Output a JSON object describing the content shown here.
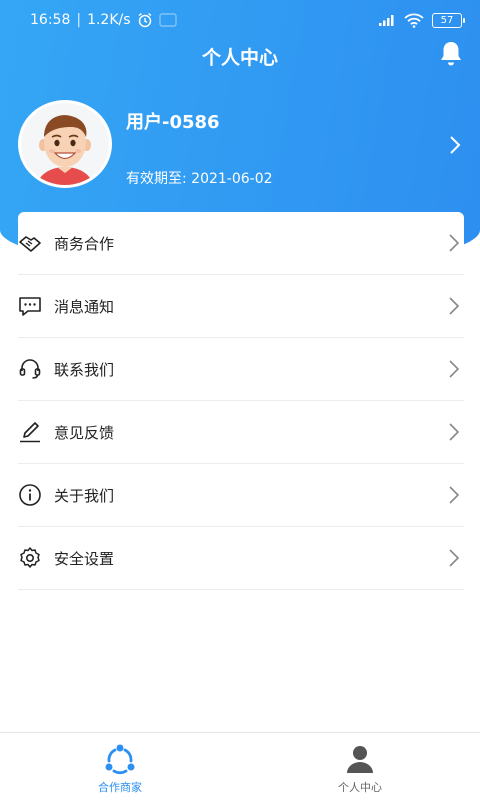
{
  "status_bar": {
    "time": "16:58",
    "speed": "1.2K/s",
    "battery": "57"
  },
  "header": {
    "title": "个人中心"
  },
  "profile": {
    "username": "用户-0586",
    "expiry": "有效期至: 2021-06-02"
  },
  "menu": {
    "items": [
      {
        "label": "商务合作",
        "icon": "handshake-icon"
      },
      {
        "label": "消息通知",
        "icon": "message-icon"
      },
      {
        "label": "联系我们",
        "icon": "headset-icon"
      },
      {
        "label": "意见反馈",
        "icon": "edit-icon"
      },
      {
        "label": "关于我们",
        "icon": "info-icon"
      },
      {
        "label": "安全设置",
        "icon": "gear-icon"
      }
    ]
  },
  "tabs": [
    {
      "label": "合作商家",
      "icon": "partners-icon",
      "active": true
    },
    {
      "label": "个人中心",
      "icon": "user-icon",
      "active": false
    }
  ],
  "colors": {
    "primary": "#2d8ff0",
    "header_gradient_start": "#35a6f5"
  }
}
